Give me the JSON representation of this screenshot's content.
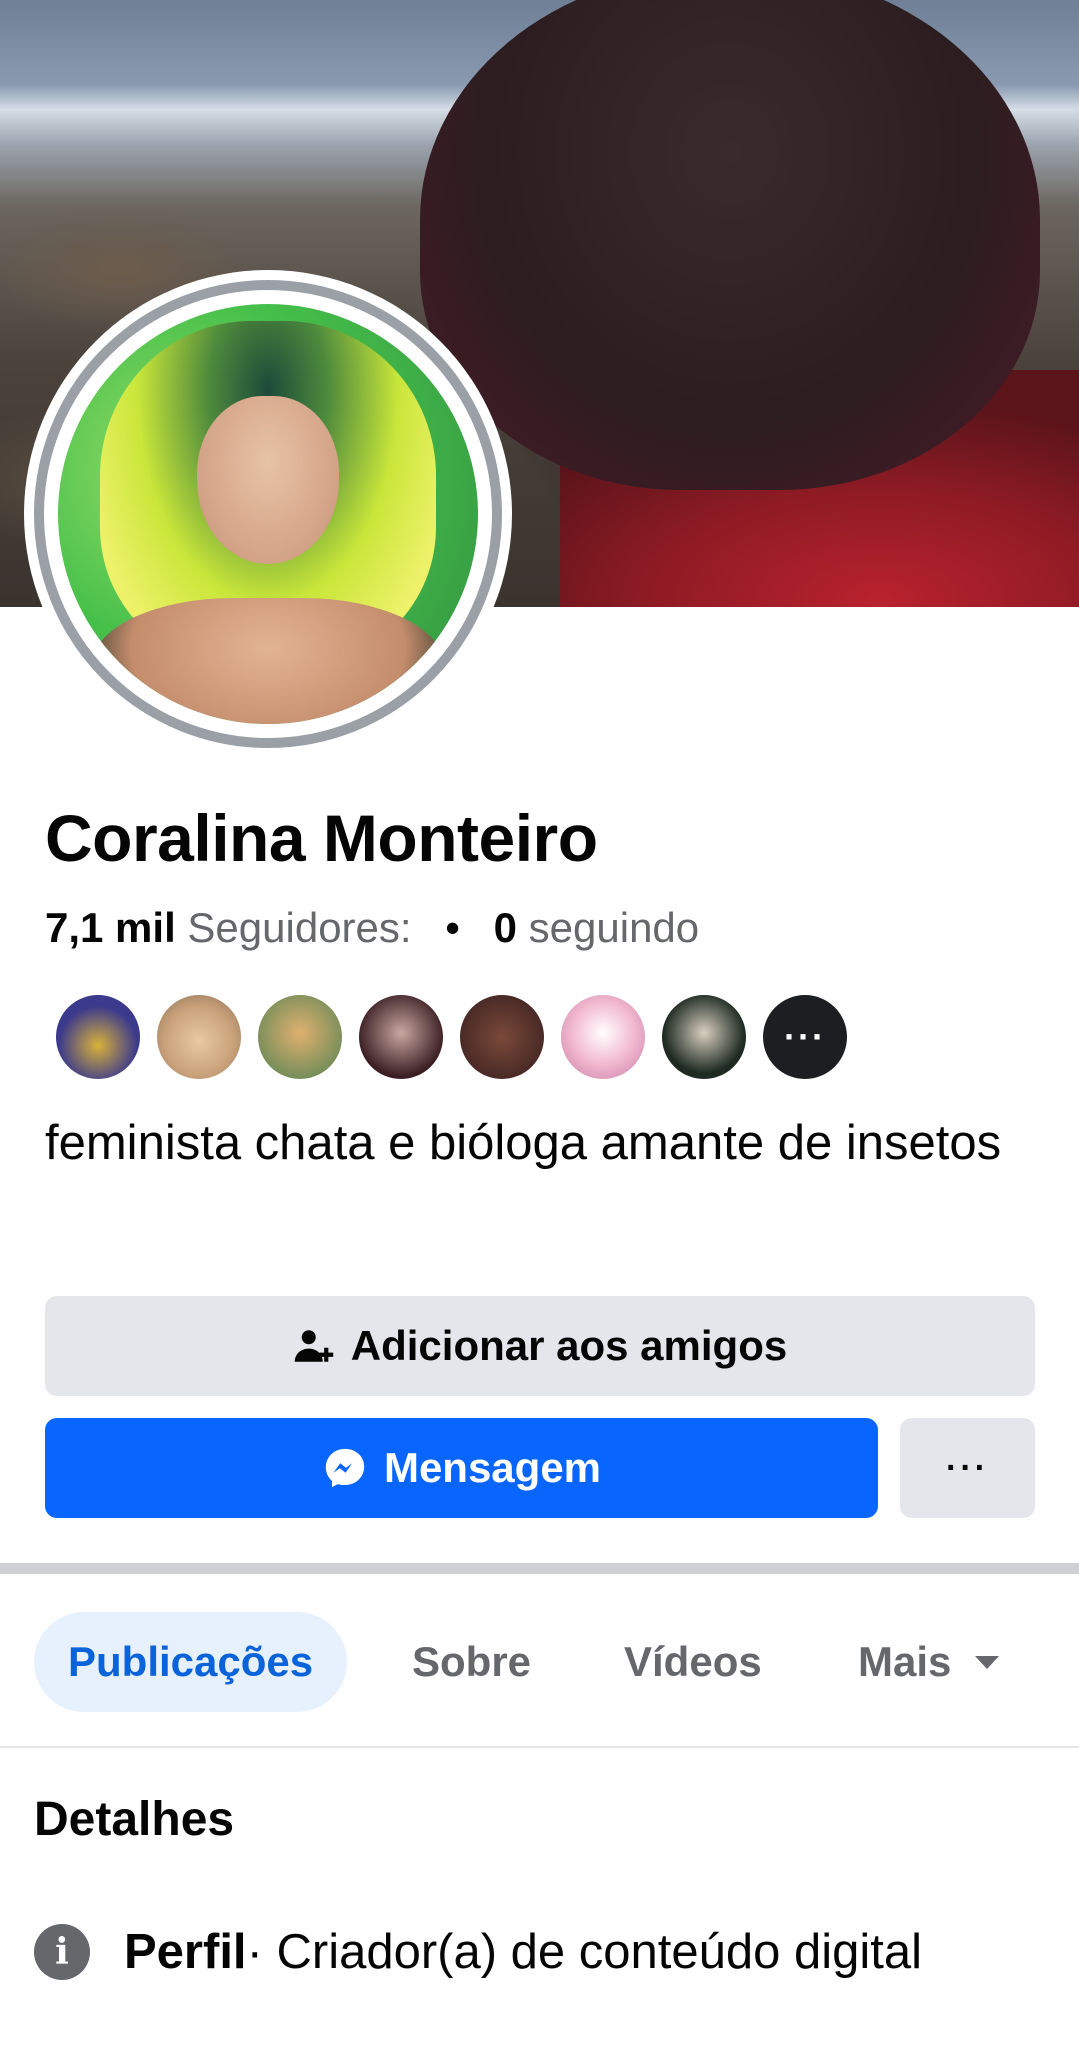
{
  "profile": {
    "name": "Coralina Monteiro",
    "followers_count": "7,1 mil",
    "followers_label": "Seguidores:",
    "following_count": "0",
    "following_label": "seguindo",
    "bio": "feminista chata e bióloga amante de insetos"
  },
  "friends_preview": {
    "more_label": "···",
    "avatar_colors": [
      "#3b3a8c",
      "#c9a27a",
      "#7a8f5a",
      "#3a1e24",
      "#4a2a26",
      "#f2b9cf",
      "#1e2a22"
    ]
  },
  "actions": {
    "add_friend_label": "Adicionar aos amigos",
    "message_label": "Mensagem",
    "more_label": "···"
  },
  "tabs": [
    {
      "label": "Publicações",
      "active": true
    },
    {
      "label": "Sobre",
      "active": false
    },
    {
      "label": "Vídeos",
      "active": false
    },
    {
      "label": "Mais",
      "active": false
    }
  ],
  "details": {
    "title": "Detalhes",
    "profile_label": "Perfil",
    "profile_value": " · Criador(a) de conteúdo digital"
  },
  "colors": {
    "brand_blue": "#0866ff",
    "active_tab_text": "#0a63d8",
    "active_tab_bg": "#e7f0fd",
    "secondary_button": "#e4e6eb"
  }
}
